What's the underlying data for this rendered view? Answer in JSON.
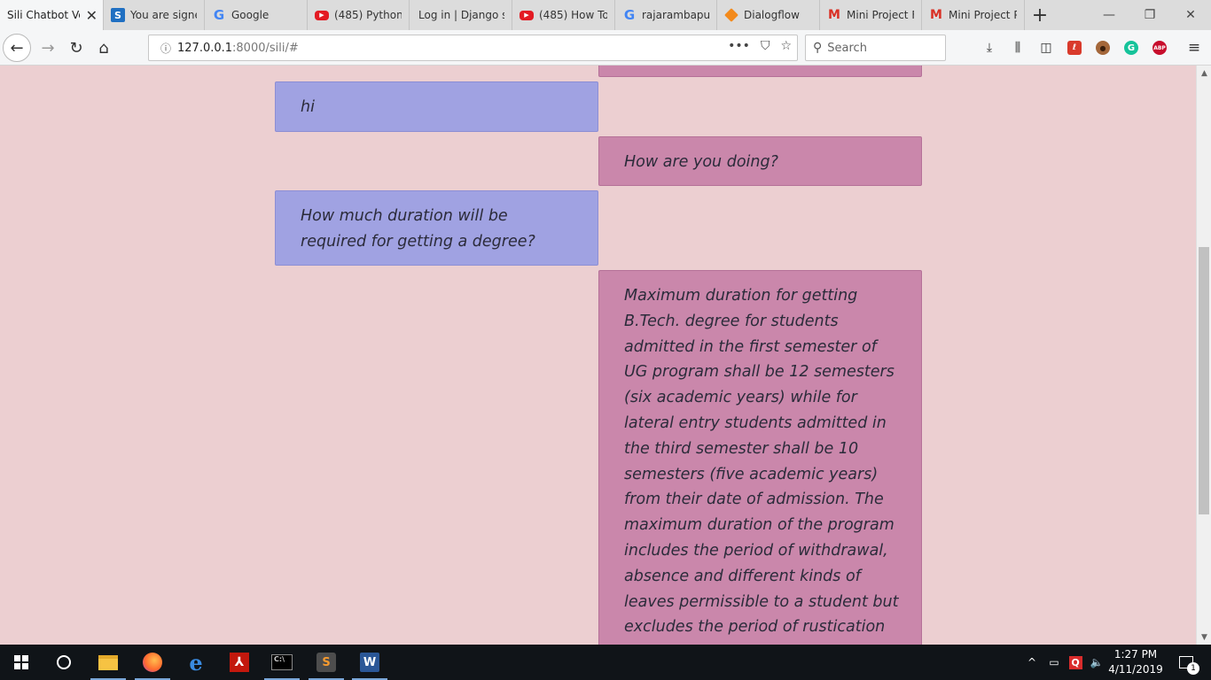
{
  "browser": {
    "tabs": [
      {
        "title": "Sili Chatbot Ve",
        "icon": "none",
        "active": true
      },
      {
        "title": "You are signe",
        "icon": "s-icon"
      },
      {
        "title": "Google",
        "icon": "google-icon"
      },
      {
        "title": "(485) Python",
        "icon": "youtube-icon"
      },
      {
        "title": "Log in | Django si",
        "icon": "none"
      },
      {
        "title": "(485) How To",
        "icon": "youtube-icon"
      },
      {
        "title": "rajarambapu",
        "icon": "google-icon"
      },
      {
        "title": "Dialogflow",
        "icon": "dialogflow-icon"
      },
      {
        "title": "Mini Project F",
        "icon": "gmail-icon"
      },
      {
        "title": "Mini Project P",
        "icon": "gmail-icon"
      }
    ],
    "url_host": "127.0.0.1",
    "url_path": ":8000/sili/#",
    "search_placeholder": "Search"
  },
  "chat": {
    "messages": [
      {
        "sender": "bot",
        "text": ""
      },
      {
        "sender": "user",
        "text": "hi"
      },
      {
        "sender": "bot",
        "text": "How are you doing?"
      },
      {
        "sender": "user",
        "text": "How much duration will be required for getting a degree?"
      },
      {
        "sender": "bot",
        "text": "Maximum duration for getting B.Tech. degree for students admitted in the first semester of UG program shall be 12 semesters (six academic years) while for lateral entry students admitted in the third semester shall be 10 semesters (five academic years) from their date of admission. The maximum duration of the program includes the period of withdrawal, absence and different kinds of leaves permissible to a student but excludes the period of rustication of a student from the"
      }
    ],
    "colors": {
      "user_bubble": "#a0a2e2",
      "bot_bubble": "#ca87ab",
      "background": "#eccfd1"
    }
  },
  "taskbar": {
    "pinned": [
      "windows-start-icon",
      "cortana-icon",
      "file-explorer-icon",
      "firefox-icon",
      "edge-icon",
      "acrobat-icon",
      "command-prompt-icon",
      "sublime-text-icon",
      "word-icon"
    ],
    "time": "1:27 PM",
    "date": "4/11/2019",
    "notification_count": "1"
  }
}
